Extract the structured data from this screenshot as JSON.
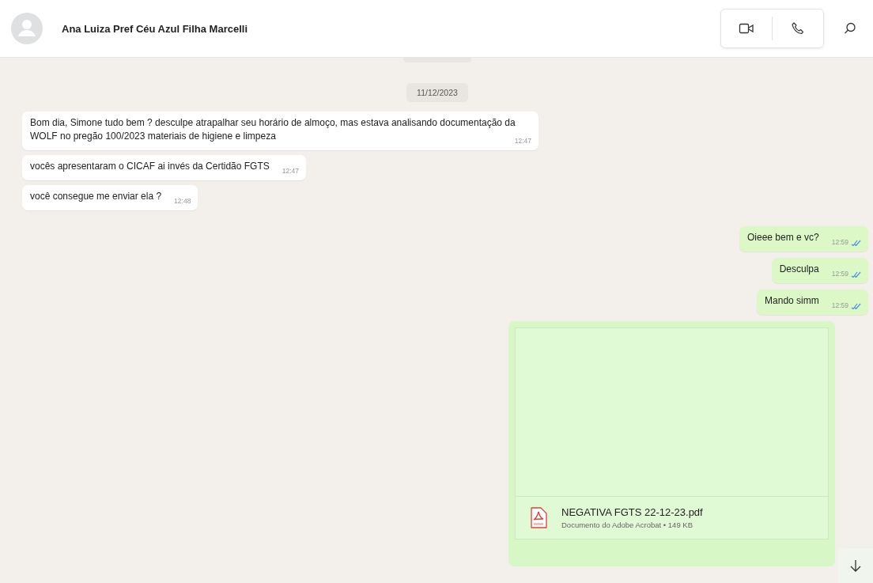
{
  "header": {
    "contact_name": "Ana Luiza Pref Céu Azul Filha Marcelli"
  },
  "date_chip": "11/12/2023",
  "messages": [
    {
      "kind": "incoming",
      "text": "Bom dia, Simone tudo bem ? desculpe atrapalhar seu horário de almoço, mas estava analisando documentação da WOLF no pregão 100/2023 materiais de higiene e limpeza",
      "time": "12:47"
    },
    {
      "kind": "incoming",
      "text": "vocês apresentaram  o CICAF ai invés da Certidão FGTS",
      "time": "12:47"
    },
    {
      "kind": "incoming",
      "text": "você consegue me enviar ela ?",
      "time": "12:48"
    },
    {
      "kind": "outgoing",
      "text": "Oieee bem e vc?",
      "time": "12:59",
      "read": true
    },
    {
      "kind": "outgoing",
      "text": "Desculpa",
      "time": "12:59",
      "read": true
    },
    {
      "kind": "outgoing",
      "text": "Mando simm",
      "time": "12:59",
      "read": true
    }
  ],
  "document": {
    "file_name": "NEGATIVA FGTS 22-12-23.pdf",
    "details": "Documento do Adobe Acrobat • 149 KB"
  }
}
